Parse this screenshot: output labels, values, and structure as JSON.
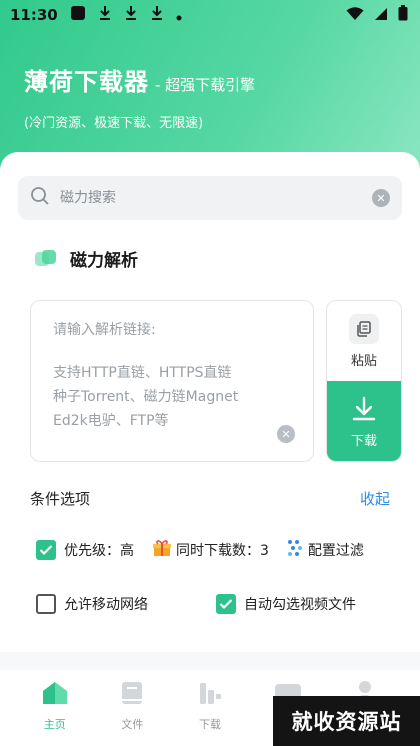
{
  "status_bar": {
    "time": "11:30"
  },
  "header": {
    "title": "薄荷下载器",
    "subtitle": "- 超强下载引擎",
    "tagline": "(冷门资源、极速下载、无限速)"
  },
  "search": {
    "placeholder": "磁力搜索",
    "value": ""
  },
  "magnet": {
    "section_title": "磁力解析",
    "input_placeholder": "请输入解析链接:",
    "hint": "支持HTTP直链、HTTPS直链\n种子Torrent、磁力链Magnet\nEd2k电驴、FTP等",
    "paste_label": "粘贴",
    "download_label": "下载"
  },
  "options": {
    "title": "条件选项",
    "collapse_label": "收起",
    "priority": {
      "label": "优先级：高",
      "checked": true
    },
    "concurrent": {
      "label": "同时下载数：3"
    },
    "filter": {
      "label": "配置过滤"
    },
    "mobile_network": {
      "label": "允许移动网络",
      "checked": false
    },
    "auto_video": {
      "label": "自动勾选视频文件",
      "checked": true
    }
  },
  "nav": {
    "items": [
      {
        "label": "主页",
        "active": true
      },
      {
        "label": "文件",
        "active": false
      },
      {
        "label": "下载",
        "active": false
      },
      {
        "label": "",
        "active": false
      },
      {
        "label": "",
        "active": false
      }
    ]
  },
  "watermark": "就收资源站",
  "colors": {
    "accent": "#2dc28b",
    "link": "#2f8ce6"
  }
}
